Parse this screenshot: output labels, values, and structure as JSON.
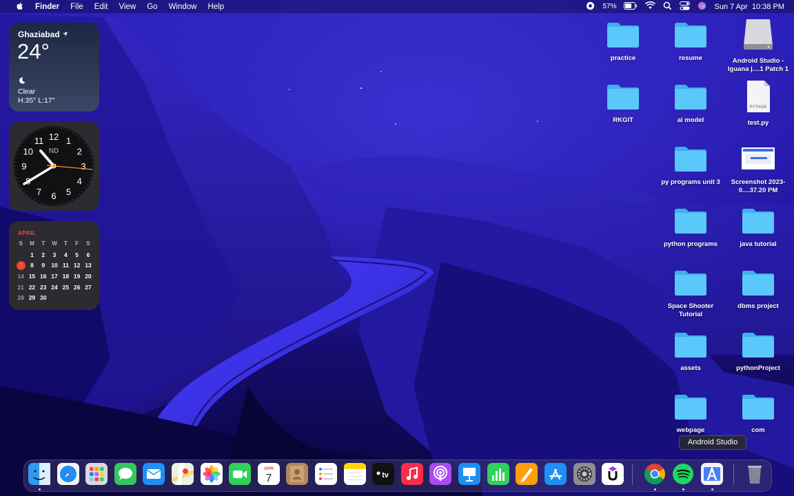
{
  "menubar": {
    "apple_icon": "apple-icon",
    "app_name": "Finder",
    "menus": [
      "File",
      "Edit",
      "View",
      "Go",
      "Window",
      "Help"
    ],
    "battery_percent": "57%",
    "datetime": "Sun 7 Apr  10:38 PM"
  },
  "weather": {
    "city": "Ghaziabad",
    "temperature": "24°",
    "condition": "Clear",
    "high_low": "H:35° L:17°"
  },
  "clock": {
    "label": "ND",
    "numbers": [
      "12",
      "1",
      "2",
      "3",
      "4",
      "5",
      "6",
      "7",
      "8",
      "9",
      "10",
      "11"
    ]
  },
  "calendar": {
    "month": "APRIL",
    "weekdays": [
      "S",
      "M",
      "T",
      "W",
      "T",
      "F",
      "S"
    ],
    "weeks": [
      [
        "",
        "1",
        "2",
        "3",
        "4",
        "5",
        "6"
      ],
      [
        "7",
        "8",
        "9",
        "10",
        "11",
        "12",
        "13"
      ],
      [
        "14",
        "15",
        "16",
        "17",
        "18",
        "19",
        "20"
      ],
      [
        "21",
        "22",
        "23",
        "24",
        "25",
        "26",
        "27"
      ],
      [
        "28",
        "29",
        "30",
        "",
        "",
        "",
        ""
      ]
    ],
    "today": "7"
  },
  "desktop_icons": [
    {
      "label": "practice",
      "type": "folder"
    },
    {
      "label": "resume",
      "type": "folder"
    },
    {
      "label": "Android Studio - Iguana |....1 Patch 1",
      "type": "disk"
    },
    {
      "label": "RKGIT",
      "type": "folder"
    },
    {
      "label": "ai model",
      "type": "folder"
    },
    {
      "label": "test.py",
      "type": "file",
      "badge": "PYTHON"
    },
    {
      "label": "py programs unit 3",
      "type": "folder"
    },
    {
      "label": "Screenshot 2023-0....37.20 PM",
      "type": "screenshot"
    },
    {
      "label": "python programs",
      "type": "folder"
    },
    {
      "label": "java tutorial",
      "type": "folder"
    },
    {
      "label": "Space Shooter Tutorial",
      "type": "folder"
    },
    {
      "label": "dbms project",
      "type": "folder"
    },
    {
      "label": "assets",
      "type": "folder"
    },
    {
      "label": "pythonProject",
      "type": "folder"
    },
    {
      "label": "webpage",
      "type": "folder"
    },
    {
      "label": "com",
      "type": "folder"
    }
  ],
  "dock": {
    "tooltip": "Android Studio",
    "calendar_month": "APR",
    "calendar_day": "7",
    "tv_label": "tv",
    "apps": [
      "finder",
      "safari",
      "launchpad",
      "messages",
      "mail",
      "maps",
      "photos",
      "facetime",
      "calendar",
      "contacts",
      "reminders",
      "notes",
      "apple-tv",
      "music",
      "podcasts",
      "keynote",
      "numbers",
      "pages",
      "app-store",
      "system-settings",
      "udemy",
      "chrome",
      "spotify",
      "android-studio",
      "trash"
    ]
  },
  "colors": {
    "folder": "#5ac8fa",
    "today_red": "#ff3b30",
    "wallpaper": "#2a1fb8"
  }
}
